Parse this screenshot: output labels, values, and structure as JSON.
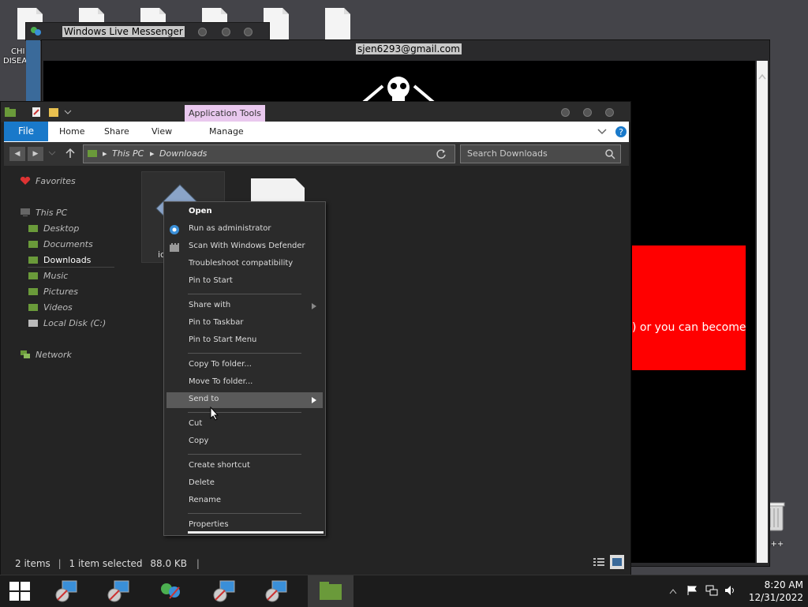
{
  "desktop": {
    "left_label_1": "CHI",
    "left_label_2": "DISEA",
    "right_label": "n C++"
  },
  "messenger": {
    "title": "Windows Live Messenger"
  },
  "email_window": {
    "title": "sjen6293@gmail.com",
    "red_text": ") or you can become"
  },
  "explorer": {
    "app_tools": "Application Tools",
    "ribbon": {
      "file": "File",
      "home": "Home",
      "share": "Share",
      "view": "View",
      "manage": "Manage"
    },
    "address": {
      "root": "This PC",
      "folder": "Downloads"
    },
    "search_placeholder": "Search Downloads",
    "nav": {
      "favorites": "Favorites",
      "this_pc": "This PC",
      "desktop": "Desktop",
      "documents": "Documents",
      "downloads": "Downloads",
      "music": "Music",
      "pictures": "Pictures",
      "videos": "Videos",
      "local_disk": "Local Disk (C:)",
      "network": "Network"
    },
    "file_partial_label": "ic",
    "status": {
      "items": "2 items",
      "selected": "1 item selected",
      "size": "88.0 KB"
    }
  },
  "context_menu": {
    "open": "Open",
    "run_admin": "Run as administrator",
    "scan": "Scan With Windows Defender",
    "troubleshoot": "Troubleshoot compatibility",
    "pin_start": "Pin to Start",
    "share_with": "Share with",
    "pin_taskbar": "Pin to Taskbar",
    "pin_start_menu": "Pin to Start Menu",
    "copy_to": "Copy To folder...",
    "move_to": "Move To folder...",
    "send_to": "Send to",
    "cut": "Cut",
    "copy": "Copy",
    "create_shortcut": "Create shortcut",
    "delete": "Delete",
    "rename": "Rename",
    "properties": "Properties"
  },
  "taskbar": {
    "time": "8:20 AM",
    "date": "12/31/2022"
  }
}
